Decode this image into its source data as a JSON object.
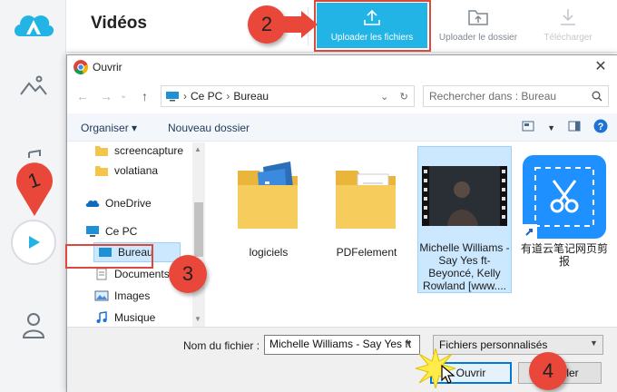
{
  "app": {
    "title": "Vidéos",
    "toolbar": {
      "upload_files": "Uploader les fichiers",
      "upload_folder": "Uploader le dossier",
      "download": "Télécharger"
    },
    "accent_color": "#21b4e4"
  },
  "dialog": {
    "title": "Ouvrir",
    "path": [
      "Ce PC",
      "Bureau"
    ],
    "search_placeholder": "Rechercher dans : Bureau",
    "commands": {
      "organize": "Organiser",
      "new_folder": "Nouveau dossier"
    },
    "nav_tree": [
      {
        "label": "screencapture",
        "icon": "folder-icon"
      },
      {
        "label": "volatiana",
        "icon": "folder-icon"
      },
      {
        "label": "OneDrive",
        "icon": "cloud-icon"
      },
      {
        "label": "Ce PC",
        "icon": "computer-icon"
      },
      {
        "label": "Bureau",
        "icon": "desktop-icon",
        "selected": true
      },
      {
        "label": "Documents",
        "icon": "documents-icon"
      },
      {
        "label": "Images",
        "icon": "images-icon"
      },
      {
        "label": "Musique",
        "icon": "music-icon"
      }
    ],
    "files": [
      {
        "label": "logiciels",
        "icon": "folder-icon"
      },
      {
        "label": "PDFelement",
        "icon": "folder-icon"
      },
      {
        "label": "Michelle Williams - Say Yes ft- Beyoncé, Kelly Rowland [www....",
        "icon": "video-file-icon",
        "selected": true
      },
      {
        "label": "有道云笔记网页剪报",
        "icon": "shortcut-app-icon"
      }
    ],
    "filename_label": "Nom du fichier :",
    "filename_value": "Michelle Williams - Say Yes ft",
    "filetype_value": "Fichiers personnalisés",
    "open_button": "Ouvrir",
    "cancel_button": "Annuler"
  },
  "annotations": {
    "step1": "1",
    "step2": "2",
    "step3": "3",
    "step4": "4"
  }
}
